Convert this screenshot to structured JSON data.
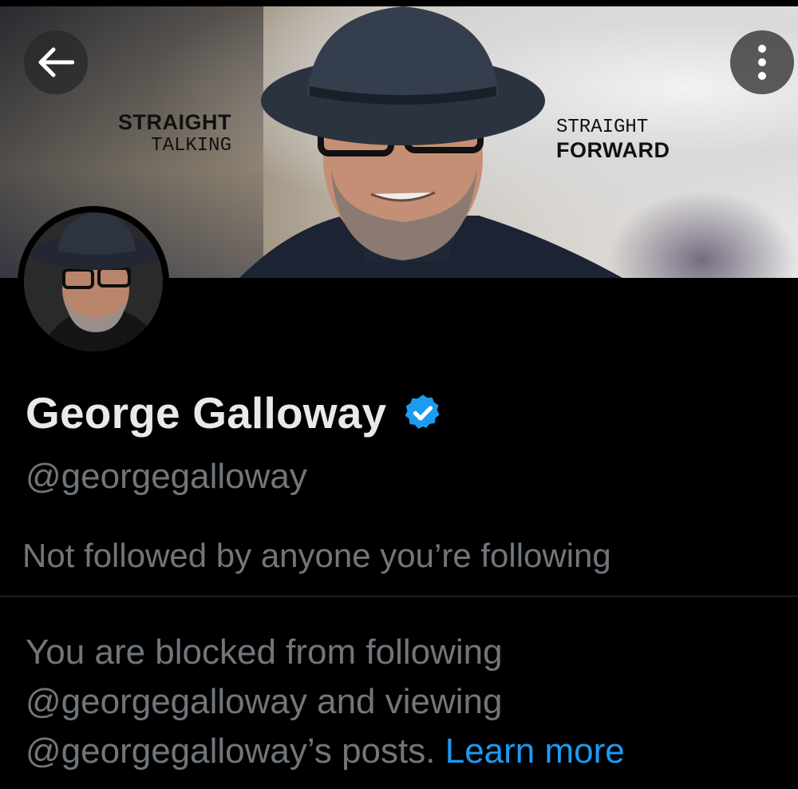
{
  "banner": {
    "left_tagline": {
      "line1": "STRAIGHT",
      "line2": "TALKING"
    },
    "right_tagline": {
      "line1": "STRAIGHT",
      "line2": "FORWARD"
    }
  },
  "header": {
    "back_icon": "arrow-left-icon",
    "more_icon": "more-vertical-icon"
  },
  "profile": {
    "name": "George Galloway",
    "verified_icon": "verified-badge-icon",
    "verified_color": "#1d9bf0",
    "handle": "@georgegalloway",
    "followers_note": "Not followed by anyone you’re following"
  },
  "blocked_notice": {
    "text": "You are blocked from following @georgegalloway and viewing @georgegalloway’s posts.",
    "link_label": "Learn more",
    "link_color": "#1d9bf0"
  }
}
